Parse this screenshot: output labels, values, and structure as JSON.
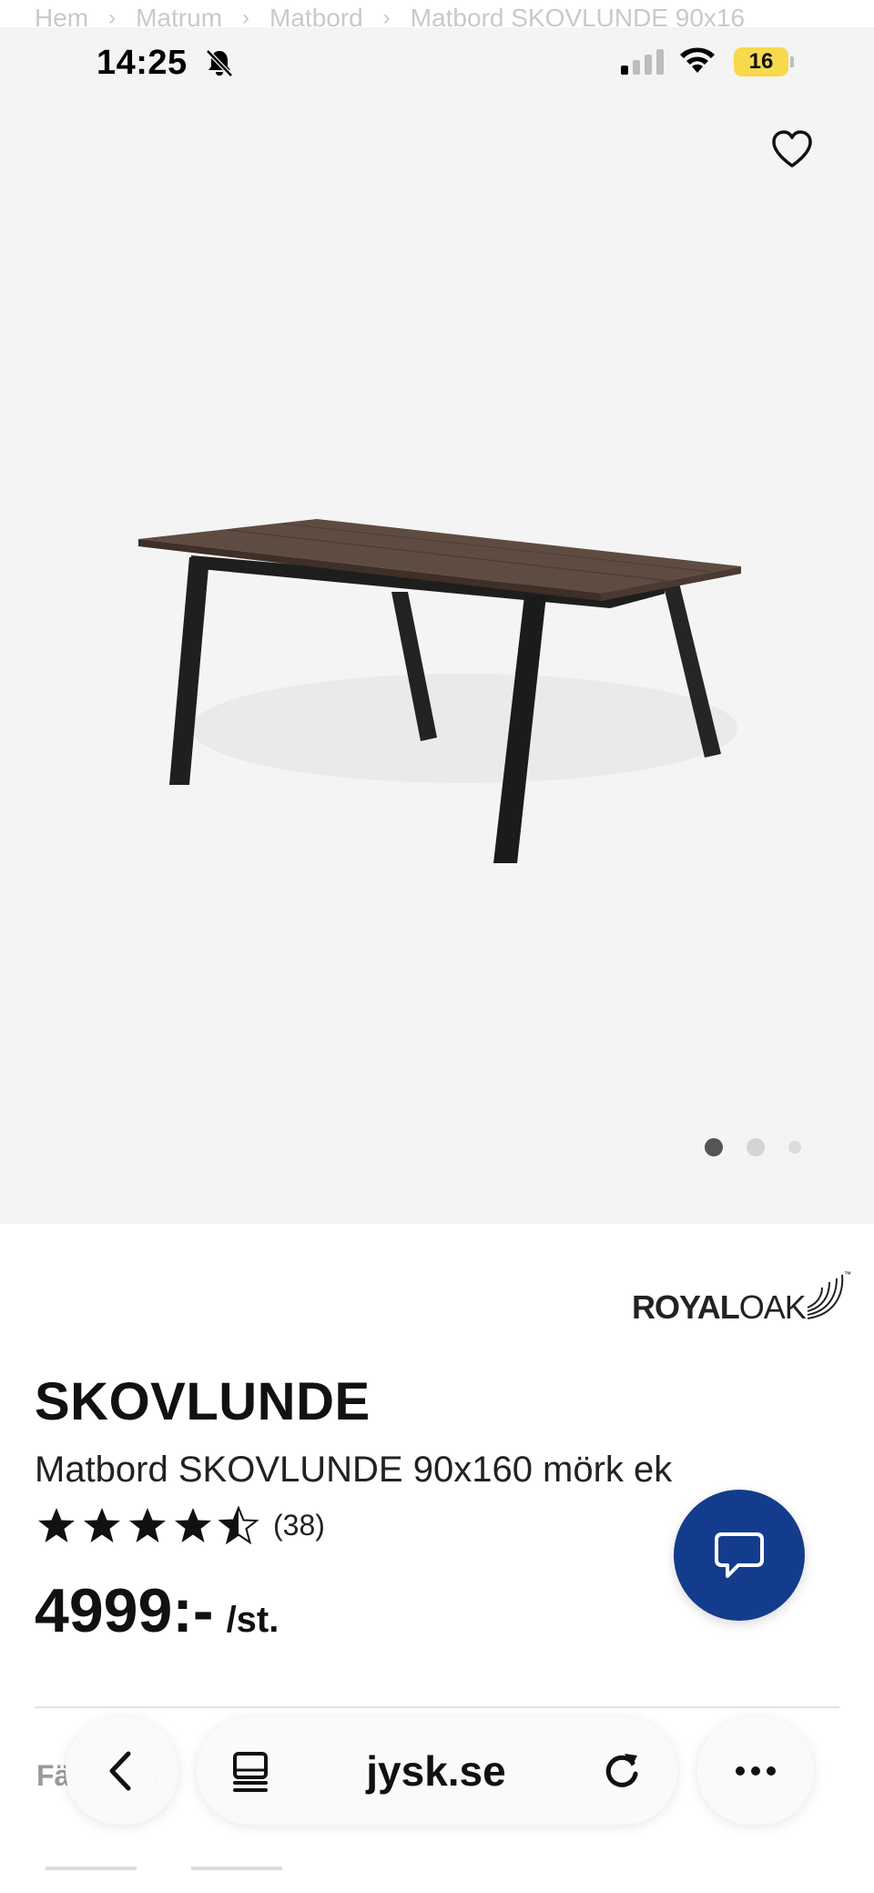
{
  "breadcrumb": [
    "Hem",
    "Matrum",
    "Matbord",
    "Matbord SKOVLUNDE 90x16"
  ],
  "status": {
    "time": "14:25",
    "battery": "16"
  },
  "gallery": {
    "total_images": 3,
    "active_index": 0
  },
  "brand": {
    "part1": "ROYAL",
    "part2": "OAK",
    "tm": "™"
  },
  "product": {
    "name": "SKOVLUNDE",
    "subtitle": "Matbord SKOVLUNDE 90x160 mörk ek",
    "rating": 4.5,
    "max_rating": 5,
    "review_count": "(38)",
    "price": "4999:-",
    "price_unit": "/st."
  },
  "options": {
    "color_label": "Fä",
    "color_value": "rk"
  },
  "browser": {
    "url": "jysk.se"
  },
  "colors": {
    "chat_button": "#143c8c",
    "image_bg": "#f4f4f4",
    "battery": "#f7d94c"
  }
}
